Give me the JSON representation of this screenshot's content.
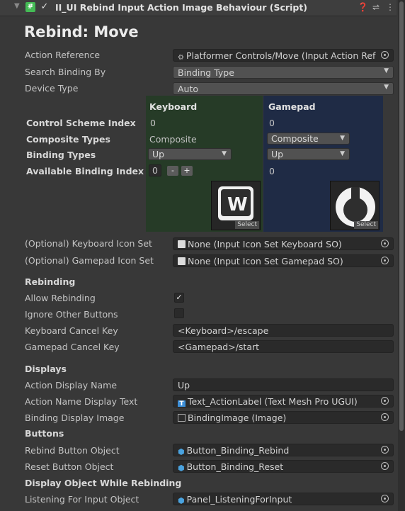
{
  "header": {
    "title": "II_UI Rebind Input Action Image Behaviour (Script)",
    "script_icon": "#"
  },
  "title": "Rebind: Move",
  "props": {
    "action_reference_label": "Action Reference",
    "action_reference_value": "Platformer Controls/Move (Input Action Ref",
    "search_binding_label": "Search Binding By",
    "search_binding_value": "Binding Type",
    "device_type_label": "Device Type",
    "device_type_value": "Auto"
  },
  "binding_table": {
    "row_labels": [
      "Control Scheme Index",
      "Composite Types",
      "Binding Types",
      "Available Binding Index"
    ],
    "keyboard": {
      "title": "Keyboard",
      "control_scheme_index": "0",
      "composite_type": "Composite",
      "binding_type": "Up",
      "available_index": "0",
      "minus": "-",
      "plus": "+",
      "tile_letter": "W",
      "select": "Select"
    },
    "gamepad": {
      "title": "Gamepad",
      "control_scheme_index": "0",
      "composite_type": "Composite",
      "binding_type": "Up",
      "available_index": "0",
      "select": "Select"
    }
  },
  "icon_sets": {
    "keyboard_label": "(Optional) Keyboard Icon Set",
    "keyboard_value": "None (Input Icon Set Keyboard SO)",
    "gamepad_label": "(Optional) Gamepad Icon Set",
    "gamepad_value": "None (Input Icon Set Gamepad SO)"
  },
  "rebinding": {
    "section": "Rebinding",
    "allow_label": "Allow Rebinding",
    "allow_checked": true,
    "ignore_label": "Ignore Other Buttons",
    "ignore_checked": false,
    "kb_cancel_label": "Keyboard Cancel Key",
    "kb_cancel_value": "<Keyboard>/escape",
    "gp_cancel_label": "Gamepad Cancel Key",
    "gp_cancel_value": "<Gamepad>/start"
  },
  "displays": {
    "section": "Displays",
    "action_display_label": "Action Display Name",
    "action_display_value": "Up",
    "action_text_label": "Action Name Display Text",
    "action_text_value": "Text_ActionLabel (Text Mesh Pro UGUI)",
    "binding_image_label": "Binding Display Image",
    "binding_image_value": "BindingImage (Image)"
  },
  "buttons": {
    "section": "Buttons",
    "rebind_label": "Rebind Button Object",
    "rebind_value": "Button_Binding_Rebind",
    "reset_label": "Reset Button Object",
    "reset_value": "Button_Binding_Reset"
  },
  "display_while": {
    "section": "Display Object While Rebinding",
    "listening_label": "Listening For Input Object",
    "listening_value": "Panel_ListeningForInput"
  },
  "colors": {
    "keyboard_panel": "#263b27",
    "gamepad_panel": "#1f2b45",
    "background": "#383838"
  }
}
